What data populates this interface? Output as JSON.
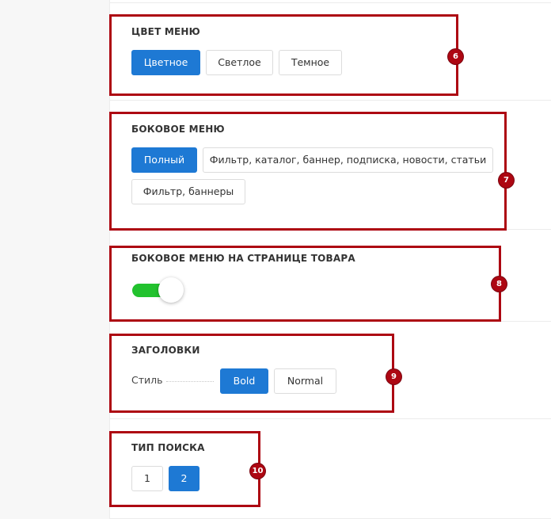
{
  "menu_color": {
    "title": "ЦВЕТ МЕНЮ",
    "options": [
      "Цветное",
      "Светлое",
      "Темное"
    ],
    "selected": "Цветное",
    "badge": "6"
  },
  "side_menu": {
    "title": "БОКОВОЕ МЕНЮ",
    "options": [
      "Полный",
      "Фильтр, каталог, баннер, подписка, новости, статьи",
      "Фильтр, баннеры"
    ],
    "selected": "Полный",
    "badge": "7"
  },
  "product_side_menu": {
    "title": "БОКОВОЕ МЕНЮ НА СТРАНИЦЕ ТОВАРА",
    "enabled": true,
    "badge": "8"
  },
  "headings": {
    "title": "ЗАГОЛОВКИ",
    "style_label": "Стиль",
    "options": [
      "Bold",
      "Normal"
    ],
    "selected": "Bold",
    "badge": "9"
  },
  "search_type": {
    "title": "ТИП ПОИСКА",
    "options": [
      "1",
      "2"
    ],
    "selected": "2",
    "badge": "10"
  },
  "colors": {
    "accent": "#1e79d4",
    "toggle_on": "#22c22e",
    "highlight": "#ad0712"
  }
}
